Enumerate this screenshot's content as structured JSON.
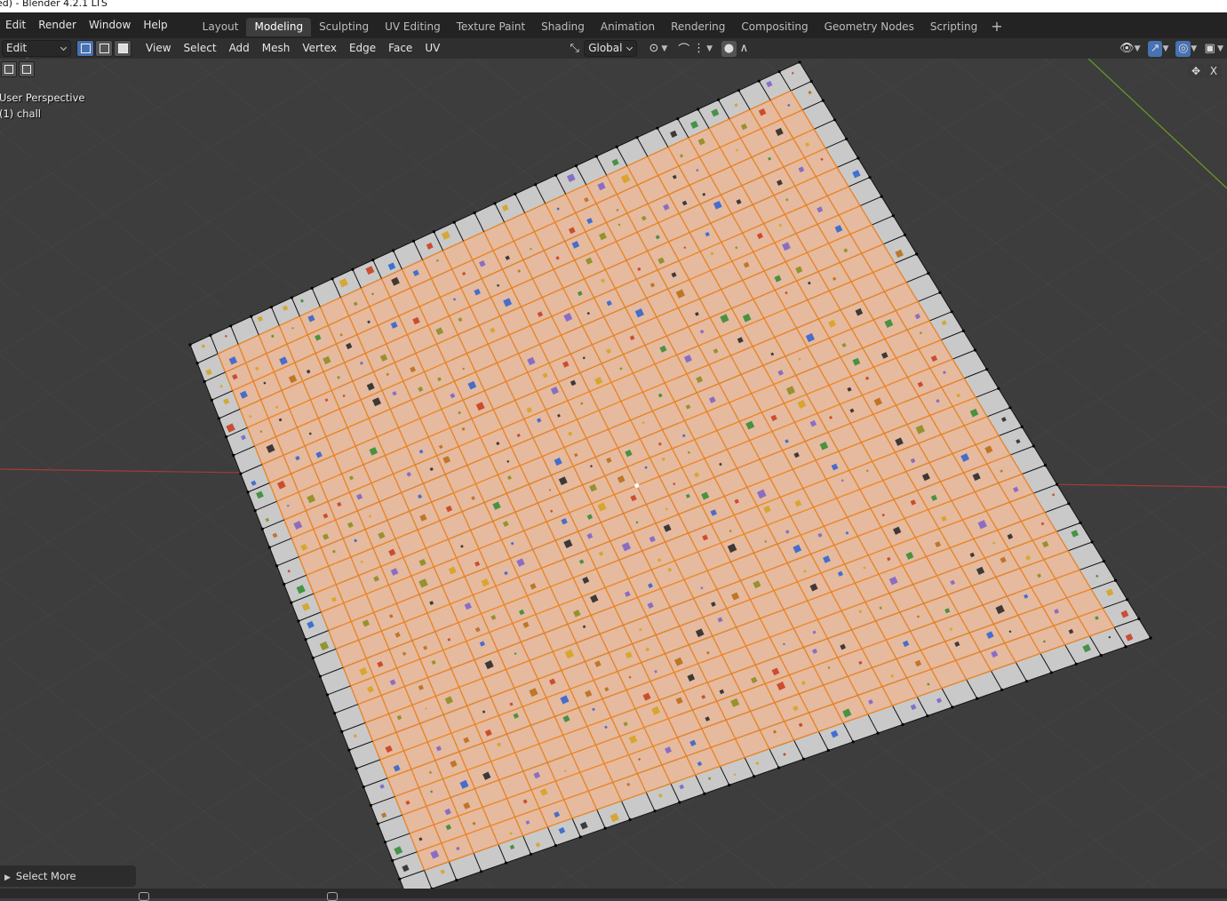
{
  "window": {
    "title": "ed) - Blender 4.2.1 LTS"
  },
  "menus": [
    "Edit",
    "Render",
    "Window",
    "Help"
  ],
  "workspaces": {
    "active": "Modeling",
    "tabs": [
      "Layout",
      "Modeling",
      "Sculpting",
      "UV Editing",
      "Texture Paint",
      "Shading",
      "Animation",
      "Rendering",
      "Compositing",
      "Geometry Nodes",
      "Scripting"
    ],
    "add_symbol": "+"
  },
  "header": {
    "mode": "Edit Mode",
    "select_modes": [
      "vertex-select-icon",
      "edge-select-icon",
      "face-select-icon"
    ],
    "menus": [
      "View",
      "Select",
      "Add",
      "Mesh",
      "Vertex",
      "Edge",
      "Face",
      "UV"
    ],
    "orientation": "Global"
  },
  "viewport": {
    "perspective": "User Perspective",
    "object": "(1) chall",
    "close_label": "X"
  },
  "operator_panel": {
    "label": "Select More"
  },
  "colors": {
    "accent": "#4772b3",
    "selection": "#ff8a1a",
    "grid_bg": "#3d3d3d",
    "axis_x": "#b23a3a",
    "axis_y": "#6a9a2a"
  }
}
